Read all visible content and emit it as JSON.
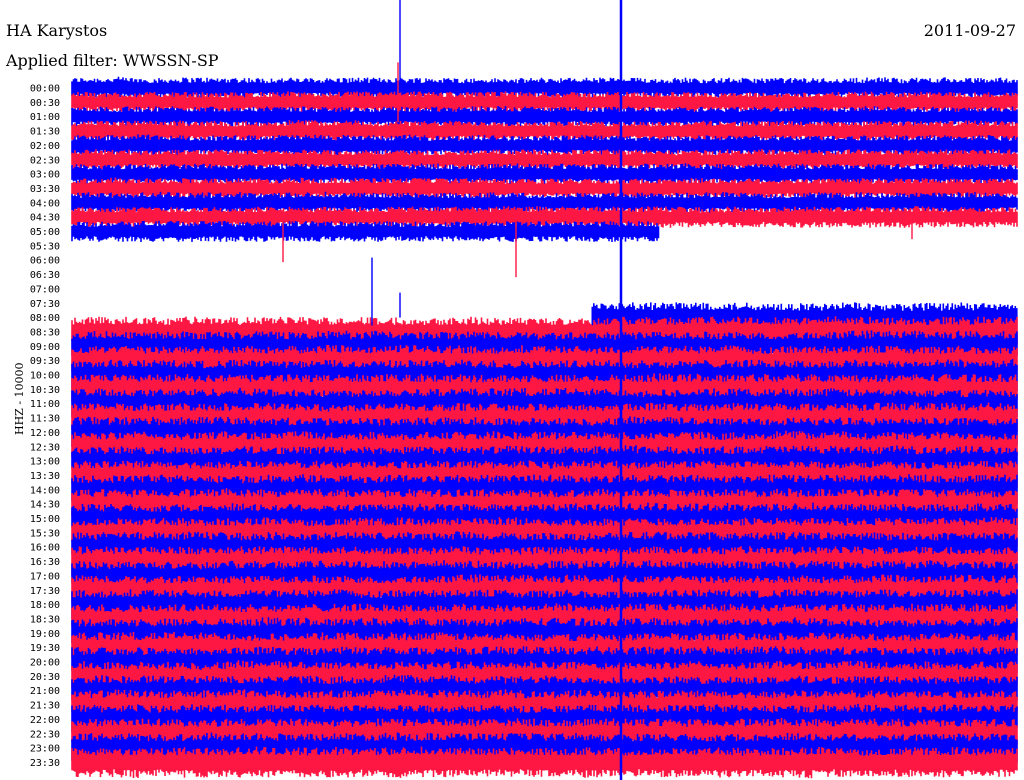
{
  "header": {
    "station": "HA Karystos",
    "date": "2011-09-27",
    "filter": "Applied filter: WWSSN-SP"
  },
  "colors": {
    "trace_a": "#0000ff",
    "trace_b": "#ff1744",
    "background": "#ffffff"
  },
  "chart_data": {
    "type": "line",
    "ylabel": "HHZ - 10000",
    "rows": [
      "00:00",
      "00:30",
      "01:00",
      "01:30",
      "02:00",
      "02:30",
      "03:00",
      "03:30",
      "04:00",
      "04:30",
      "05:00",
      "05:30",
      "06:00",
      "06:30",
      "07:00",
      "07:30",
      "08:00",
      "08:30",
      "09:00",
      "09:30",
      "10:00",
      "10:30",
      "11:00",
      "11:30",
      "12:00",
      "12:30",
      "13:00",
      "13:30",
      "14:00",
      "14:30",
      "15:00",
      "15:30",
      "16:00",
      "16:30",
      "17:00",
      "17:30",
      "18:00",
      "18:30",
      "19:00",
      "19:30",
      "20:00",
      "20:30",
      "21:00",
      "21:30",
      "22:00",
      "22:30",
      "23:00",
      "23:30"
    ],
    "row_minutes": 30,
    "gap_start": "05:00",
    "gap_end": "08:00",
    "gap_start_fraction": 0.62,
    "gap_end_fraction": 0.55,
    "grid": false
  }
}
